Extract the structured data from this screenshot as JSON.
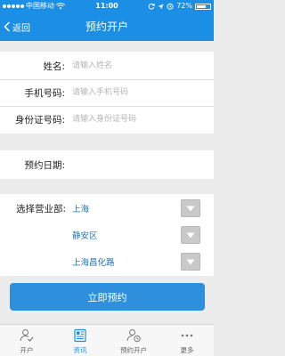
{
  "status_bar": {
    "carrier": "中国移动",
    "time": "11:00",
    "battery": "72%",
    "battery_level": 0.72
  },
  "nav": {
    "back_label": "返回",
    "title": "预约开户"
  },
  "form": {
    "name": {
      "label": "姓名:",
      "placeholder": "请输入姓名"
    },
    "phone": {
      "label": "手机号码:",
      "placeholder": "请输入手机号码"
    },
    "id_number": {
      "label": "身份证号码:",
      "placeholder": "请输入身份证号码"
    },
    "date": {
      "label": "预约日期:"
    }
  },
  "branch": {
    "label": "选择营业部:",
    "city": "上海",
    "district": "静安区",
    "office": "上海昌化路"
  },
  "submit_label": "立即预约",
  "tabs": [
    {
      "label": "开户",
      "icon": "account-person-check-icon",
      "active": false
    },
    {
      "label": "资讯",
      "icon": "news-document-icon",
      "active": true
    },
    {
      "label": "预约开户",
      "icon": "appointment-person-clock-icon",
      "active": false
    },
    {
      "label": "更多",
      "icon": "more-dots-icon",
      "active": false
    }
  ],
  "colors": {
    "primary": "#1b8ee6",
    "button": "#2e8fdc",
    "select_value": "#2574b4",
    "background": "#ececec"
  }
}
